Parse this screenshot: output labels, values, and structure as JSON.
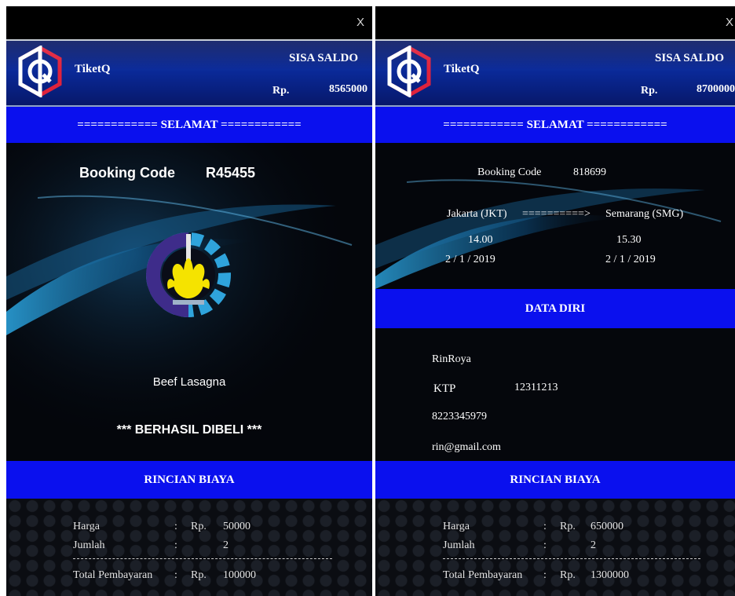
{
  "panels": [
    {
      "close_label": "X",
      "app_name": "TiketQ",
      "saldo_title": "SISA SALDO",
      "saldo_currency": "Rp.",
      "saldo_value": "8565000",
      "greeting": "============ SELAMAT ============",
      "booking_code_label": "Booking Code",
      "booking_code": "R45455",
      "item_name": "Beef Lasagna",
      "status": "*** BERHASIL DIBELI ***",
      "cost_title": "RINCIAN BIAYA",
      "cost": {
        "harga_label": "Harga",
        "jumlah_label": "Jumlah",
        "total_label": "Total Pembayaran",
        "colon": ":",
        "currency": "Rp.",
        "harga": "50000",
        "jumlah": "2",
        "total": "100000"
      }
    },
    {
      "close_label": "X",
      "app_name": "TiketQ",
      "saldo_title": "SISA SALDO",
      "saldo_currency": "Rp.",
      "saldo_value": "8700000",
      "greeting": "============ SELAMAT ============",
      "booking_code_label": "Booking Code",
      "booking_code": "818699",
      "origin": "Jakarta (JKT)",
      "arrow": "==========>",
      "destination": "Semarang (SMG)",
      "depart_time": "14.00",
      "arrive_time": "15.30",
      "depart_date": "2 / 1 / 2019",
      "arrive_date": "2 / 1 / 2019",
      "data_title": "DATA DIRI",
      "name": "RinRoya",
      "ktp_label": "KTP",
      "ktp": "12311213",
      "phone": "8223345979",
      "email": "rin@gmail.com",
      "cost_title": "RINCIAN BIAYA",
      "cost": {
        "harga_label": "Harga",
        "jumlah_label": "Jumlah",
        "total_label": "Total Pembayaran",
        "colon": ":",
        "currency": "Rp.",
        "harga": "650000",
        "jumlah": "2",
        "total": "1300000"
      }
    }
  ],
  "colors": {
    "accent_blue": "#0a10ee",
    "header_blue": "#0a2a9a",
    "logo_red": "#e0223c"
  }
}
